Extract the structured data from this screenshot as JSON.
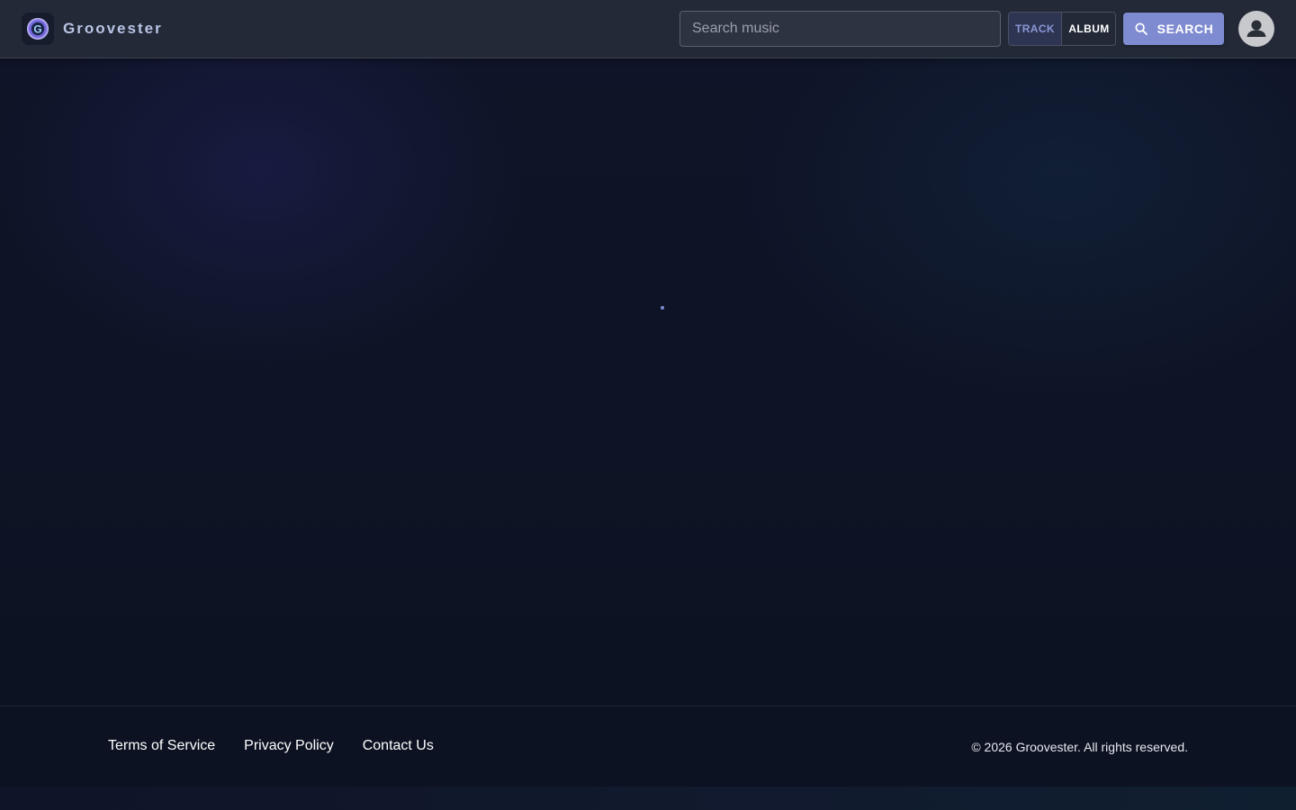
{
  "app": {
    "name": "Groovester",
    "logo_letter": "G"
  },
  "header": {
    "search": {
      "placeholder": "Search music",
      "value": ""
    },
    "toggle": {
      "options": [
        "TRACK",
        "ALBUM"
      ],
      "selected": "TRACK"
    },
    "search_button_label": "SEARCH"
  },
  "main": {
    "loading": true
  },
  "footer": {
    "links": [
      "Terms of Service",
      "Privacy Policy",
      "Contact Us"
    ],
    "copyright": "© 2026 Groovester. All rights reserved."
  },
  "colors": {
    "accent": "#7f8bd1",
    "header_bg": "#232937",
    "page_bg": "#0e1425",
    "footer_bg": "#0c1222"
  },
  "icons": {
    "logo": "groovester-logo-icon",
    "search_button": "search-icon",
    "avatar": "person-icon"
  }
}
